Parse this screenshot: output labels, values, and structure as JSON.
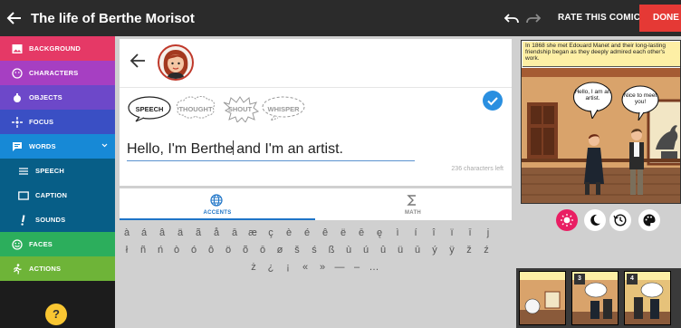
{
  "header": {
    "title": "The life of Berthe Morisot",
    "rate_label": "RATE THIS COMIC",
    "done_label": "DONE"
  },
  "sidebar": {
    "items": [
      {
        "label": "BACKGROUND",
        "color": "#e53966",
        "icon": "image-icon"
      },
      {
        "label": "CHARACTERS",
        "color": "#a63fc2",
        "icon": "face-icon"
      },
      {
        "label": "OBJECTS",
        "color": "#6d48c9",
        "icon": "object-icon"
      },
      {
        "label": "FOCUS",
        "color": "#3a4fc4",
        "icon": "focus-icon"
      },
      {
        "label": "WORDS",
        "color": "#1789d6",
        "icon": "speech-bubble-icon"
      },
      {
        "label": "SPEECH",
        "color": "#075e87",
        "icon": "lines-icon"
      },
      {
        "label": "CAPTION",
        "color": "#075e87",
        "icon": "caption-icon"
      },
      {
        "label": "SOUNDS",
        "color": "#075e87",
        "icon": "exclamation-icon"
      },
      {
        "label": "FACES",
        "color": "#2cae5c",
        "icon": "smiley-icon"
      },
      {
        "label": "ACTIONS",
        "color": "#6eb438",
        "icon": "running-icon"
      }
    ],
    "help_label": "?"
  },
  "editor": {
    "bubble_types": [
      "SPEECH",
      "THOUGHT",
      "SHOUT",
      "WHISPER"
    ],
    "text_before_cursor": "Hello, I'm Berthe",
    "text_after_cursor": " and I'm an artist.",
    "chars_left": "236 characters left"
  },
  "keyboard": {
    "tabs": [
      {
        "label": "ACCENTS",
        "icon": "globe-icon"
      },
      {
        "label": "MATH",
        "icon": "sigma-icon"
      }
    ],
    "row1": [
      "à",
      "á",
      "â",
      "ä",
      "ã",
      "å",
      "ā",
      "æ",
      "ç",
      "è",
      "é",
      "ê",
      "ë",
      "ē",
      "ę",
      "ì",
      "í",
      "î",
      "ï",
      "ī",
      "j"
    ],
    "row2": [
      "ł",
      "ñ",
      "ń",
      "ò",
      "ó",
      "ô",
      "ö",
      "õ",
      "ō",
      "ø",
      "š",
      "ś",
      "ß",
      "ù",
      "ú",
      "û",
      "ü",
      "ū",
      "ý",
      "ÿ",
      "ž",
      "ź"
    ],
    "row3": [
      "ż",
      "¿",
      "¡",
      "«",
      "»",
      "—",
      "–",
      "…"
    ]
  },
  "comic": {
    "caption": "In 1868 she met Edouard Manet and their long-lasting friendship began as they deeply admired each other's work.",
    "speech1": "Hello, I am an artist.",
    "speech2": "Nice to meet you!",
    "controls": [
      "brightness-icon",
      "moon-icon",
      "history-icon",
      "palette-icon"
    ],
    "thumb_numbers": [
      "3",
      "4"
    ]
  },
  "colors": {
    "topbar": "#2b2b2b",
    "done": "#e53935",
    "accent": "#1e74c7",
    "control_active": "#e91e63",
    "caption_bg": "#fdefa5"
  }
}
